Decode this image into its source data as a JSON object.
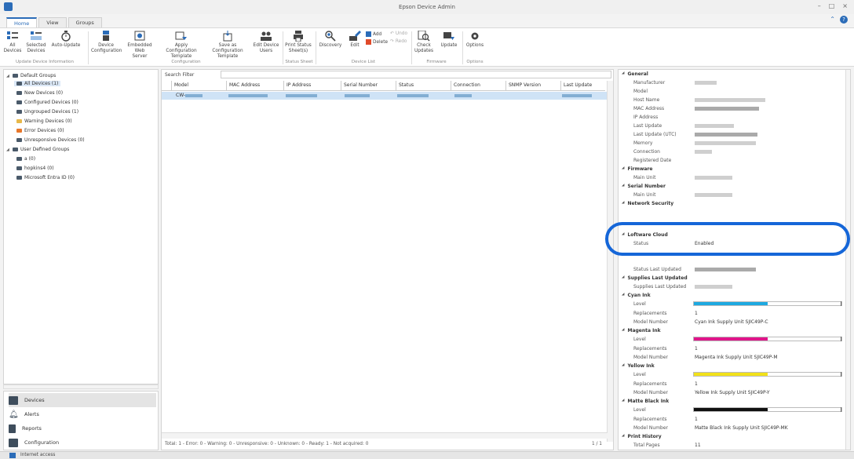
{
  "window": {
    "title": "Epson Device Admin",
    "controls": [
      "–",
      "□",
      "×"
    ],
    "help": [
      "⌃",
      "?"
    ]
  },
  "tabs": [
    {
      "label": "Home",
      "active": true
    },
    {
      "label": "View",
      "active": false
    },
    {
      "label": "Groups",
      "active": false
    }
  ],
  "ribbon": {
    "buttons": [
      {
        "label": "All\nDevices",
        "icon": "all-devices-icon"
      },
      {
        "label": "Selected\nDevices",
        "icon": "selected-devices-icon"
      },
      {
        "label": "Auto-Update",
        "icon": "auto-update-icon"
      },
      {
        "label": "Device\nConfiguration",
        "icon": "device-configuration-icon"
      },
      {
        "label": "Embedded Web\nServer",
        "icon": "embedded-web-server-icon"
      },
      {
        "label": "Apply Configuration\nTemplate",
        "icon": "apply-template-icon"
      },
      {
        "label": "Save as Configuration\nTemplate",
        "icon": "save-template-icon"
      },
      {
        "label": "Edit Device\nUsers",
        "icon": "edit-users-icon"
      },
      {
        "label": "Print Status\nSheet(s)",
        "icon": "print-status-icon"
      },
      {
        "label": "Discovery",
        "icon": "discovery-icon"
      },
      {
        "label": "Edit",
        "icon": "edit-icon"
      },
      {
        "label": "Check\nUpdates",
        "icon": "check-updates-icon"
      },
      {
        "label": "Update",
        "icon": "update-icon"
      },
      {
        "label": "Options",
        "icon": "options-icon"
      }
    ],
    "small": {
      "add": "Add",
      "delete": "Delete",
      "undo": "Undo",
      "redo": "Redo"
    },
    "groups": [
      "Update Device Information",
      "Configuration",
      "Status Sheet",
      "Device List",
      "Firmware",
      "Options"
    ]
  },
  "tree": {
    "items": [
      {
        "label": "Default Groups",
        "level": 0,
        "caret": "◢",
        "folder": "dark"
      },
      {
        "label": "All Devices (1)",
        "level": 1,
        "folder": "dark",
        "selected": true
      },
      {
        "label": "New Devices (0)",
        "level": 1,
        "folder": "dark"
      },
      {
        "label": "Configured Devices (0)",
        "level": 1,
        "folder": "dark"
      },
      {
        "label": "Ungrouped Devices (1)",
        "level": 1,
        "folder": "dark"
      },
      {
        "label": "Warning Devices (0)",
        "level": 1,
        "folder": "yellow"
      },
      {
        "label": "Error Devices (0)",
        "level": 1,
        "folder": "orange"
      },
      {
        "label": "Unresponsive Devices (0)",
        "level": 1,
        "folder": "dark"
      },
      {
        "label": "User Defined Groups",
        "level": 0,
        "caret": "◢",
        "folder": "dark"
      },
      {
        "label": "a (0)",
        "level": 1,
        "folder": "dark"
      },
      {
        "label": "hopkins4 (0)",
        "level": 1,
        "folder": "dark"
      },
      {
        "label": "Microsoft Entra ID (0)",
        "level": 1,
        "folder": "dark"
      }
    ]
  },
  "nav": {
    "items": [
      {
        "label": "Devices",
        "icon": "devices-icon",
        "active": true
      },
      {
        "label": "Alerts",
        "icon": "bell-icon"
      },
      {
        "label": "Reports",
        "icon": "reports-icon"
      },
      {
        "label": "Configuration",
        "icon": "configuration-icon"
      }
    ]
  },
  "grid": {
    "filter_label": "Search Filter",
    "columns": [
      "Model",
      "MAC Address",
      "IP Address",
      "Serial Number",
      "Status",
      "Connection",
      "SNMP Version",
      "Last Update"
    ],
    "rows": [
      {
        "model": "CW-"
      }
    ],
    "status": "Total: 1 - Error: 0 - Warning: 0 - Unresponsive: 0 - Unknown: 0 - Ready: 1 - Not acquired: 0",
    "pages": "1  /  1"
  },
  "properties": {
    "general": {
      "title": "General",
      "rows": [
        "Manufacturer",
        "Model",
        "Host Name",
        "MAC Address",
        "IP Address",
        "Last Update",
        "Last Update (UTC)",
        "Memory",
        "Connection",
        "Registered Date"
      ]
    },
    "firmware": {
      "title": "Firmware",
      "rows": [
        "Main Unit"
      ]
    },
    "serial": {
      "title": "Serial Number",
      "rows": [
        "Main Unit"
      ]
    },
    "network_security": {
      "title": "Network Security"
    },
    "cloud": {
      "title": "Loftware Cloud",
      "status_label": "Status",
      "status_value": "Enabled"
    },
    "status_last_updated": "Status Last Updated",
    "supplies": {
      "title": "Supplies Last Updated",
      "row": "Supplies Last Updated"
    },
    "inks": [
      {
        "title": "Cyan Ink",
        "level": 0.5,
        "color": "#1ea9e1",
        "replacements": "1",
        "model": "Cyan Ink Supply Unit SJIC49P-C"
      },
      {
        "title": "Magenta Ink",
        "level": 0.5,
        "color": "#e0158a",
        "replacements": "1",
        "model": "Magenta Ink Supply Unit SJIC49P-M"
      },
      {
        "title": "Yellow Ink",
        "level": 0.5,
        "color": "#f2e11a",
        "replacements": "1",
        "model": "Yellow Ink Supply Unit SJIC49P-Y"
      },
      {
        "title": "Matte Black Ink",
        "level": 0.5,
        "color": "#111111",
        "replacements": "1",
        "model": "Matte Black Ink Supply Unit SJIC49P-MK"
      }
    ],
    "ink_labels": {
      "level": "Level",
      "replacements": "Replacements",
      "model": "Model Number"
    },
    "print_history": {
      "title": "Print History",
      "row": "Total Pages",
      "value": "11"
    }
  },
  "statusbar": {
    "text": "Internet access"
  }
}
